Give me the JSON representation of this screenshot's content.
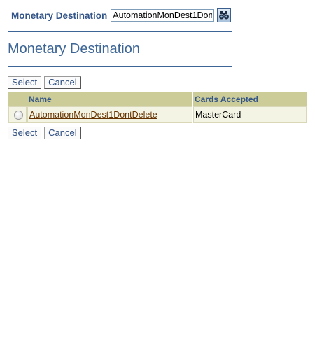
{
  "search": {
    "label": "Monetary Destination",
    "value": "AutomationMonDest1DontDelete",
    "button_icon": "binoculars-icon"
  },
  "page_title": "Monetary Destination",
  "actions": {
    "select_label": "Select",
    "cancel_label": "Cancel"
  },
  "table": {
    "columns": [
      "",
      "Name",
      "Cards Accepted"
    ],
    "rows": [
      {
        "selected": false,
        "name": "AutomationMonDest1DontDelete",
        "cards_accepted": "MasterCard"
      }
    ]
  },
  "colors": {
    "heading": "#3d6696",
    "header_bg": "#cccc99",
    "row_bg": "#f4f4e4",
    "link": "#663300"
  }
}
